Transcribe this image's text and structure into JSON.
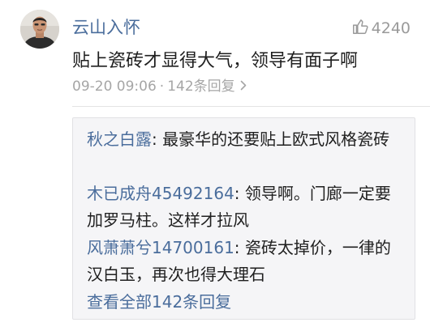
{
  "comment": {
    "username": "云山入怀",
    "likes": "4240",
    "text": "贴上瓷砖才显得大气，领导有面子啊",
    "timestamp": "09-20 09:06",
    "separator": "·",
    "reply_count_label": "142条回复",
    "icons": {
      "like": "thumbs-up-icon",
      "replies": "chevron-right-icon"
    }
  },
  "replies": [
    {
      "name": "秋之白露",
      "text": ": 最豪华的还要贴上欧式风格瓷砖"
    },
    {
      "name": "木已成舟45492164",
      "text": ": 领导啊。门廊一定要加罗马柱。这样才拉风"
    },
    {
      "name": "风萧萧兮14700161",
      "text": ": 瓷砖太掉价，一律的汉白玉，再次也得大理石"
    }
  ],
  "view_all_label": "查看全部142条回复",
  "colors": {
    "link": "#4a6d9c",
    "meta": "#a6a6a6",
    "reply_bg": "#f5f5f7"
  }
}
